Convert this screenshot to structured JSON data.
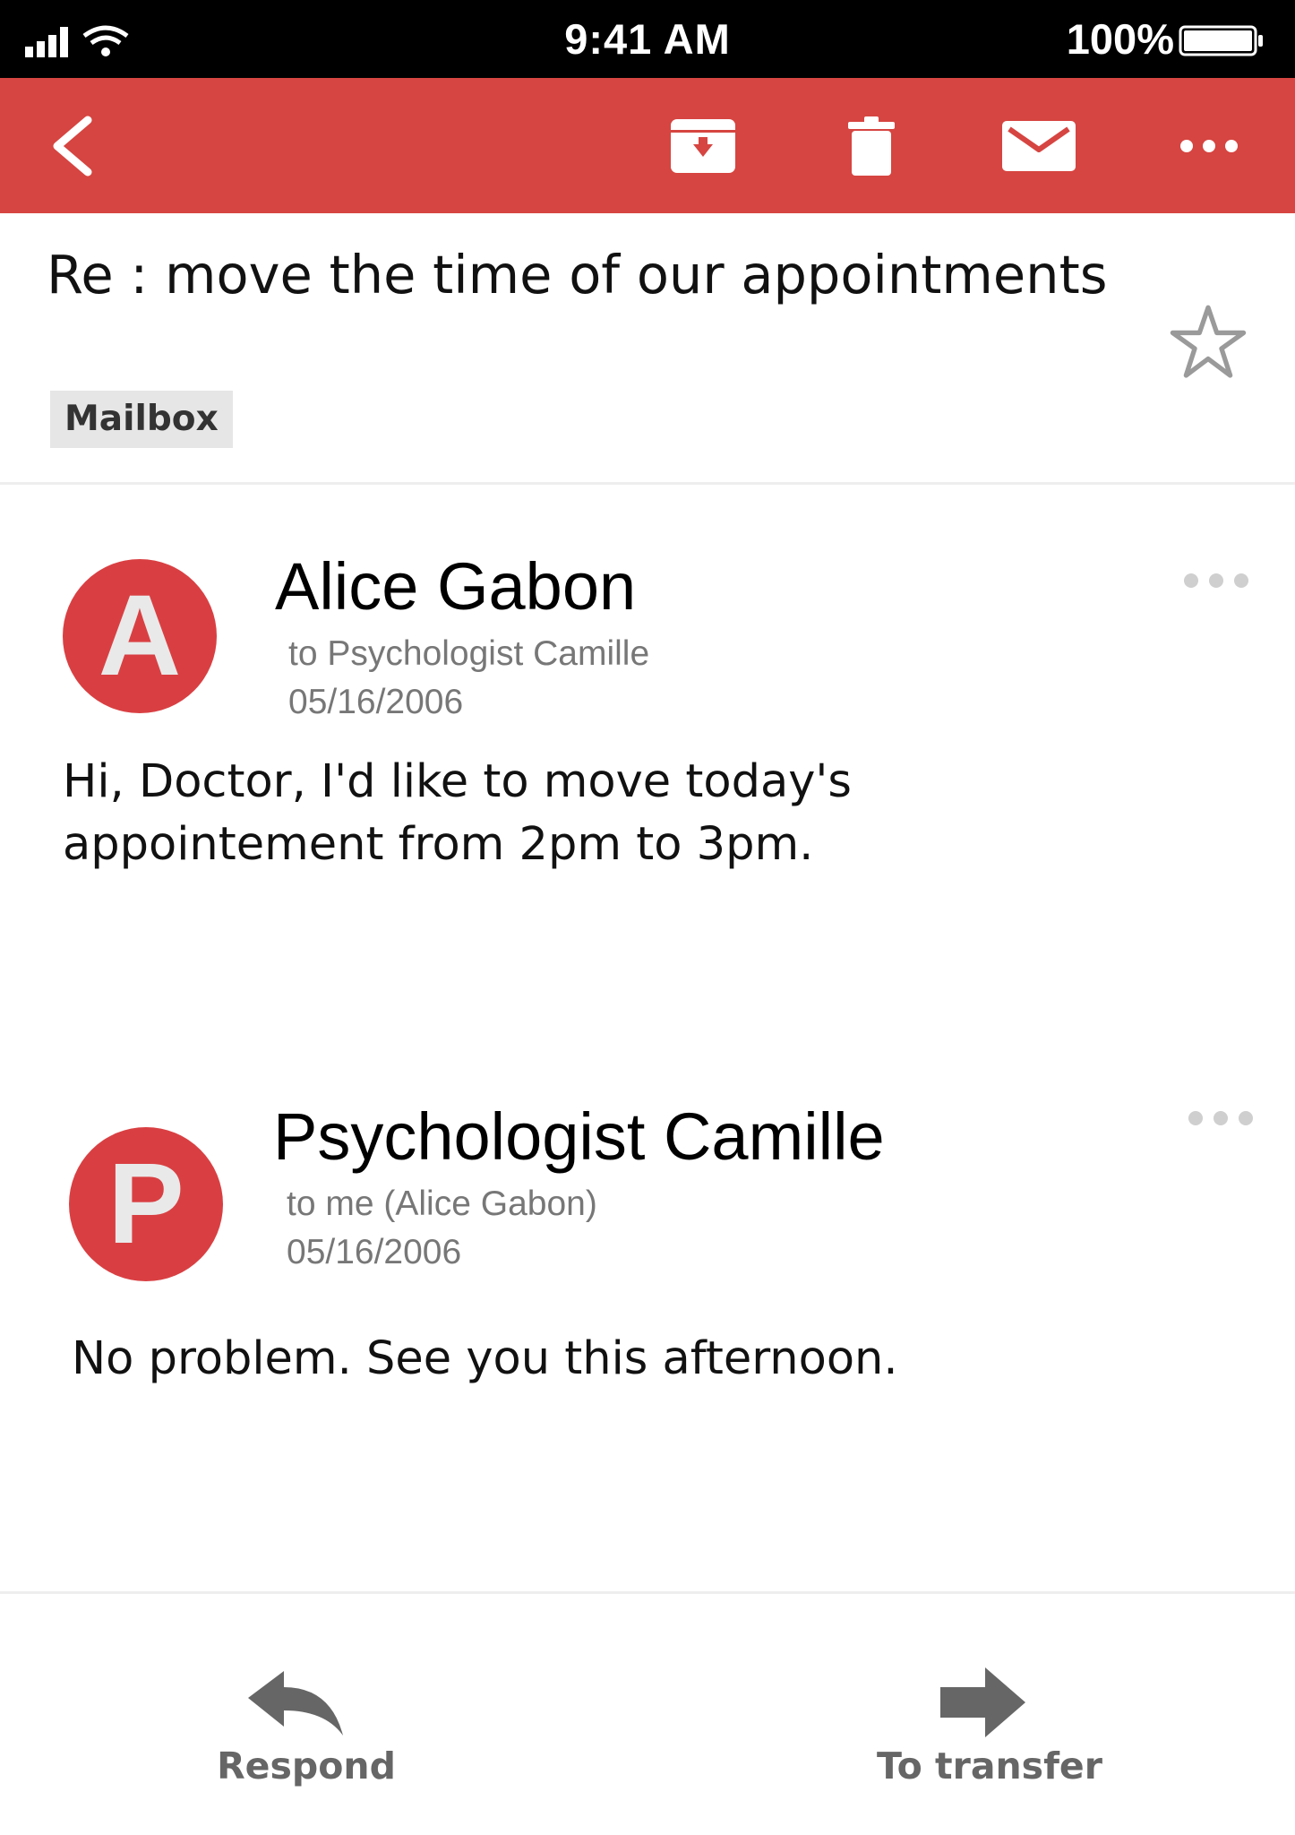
{
  "status_bar": {
    "time": "9:41 AM",
    "battery": "100%"
  },
  "toolbar": {
    "back": "back",
    "archive": "archive",
    "delete": "delete",
    "mark_unread": "mark unread",
    "more": "more"
  },
  "subject": {
    "title": "Re : move the time of our appointments",
    "label": "Mailbox"
  },
  "messages": [
    {
      "avatar_letter": "A",
      "sender": "Alice Gabon",
      "to": "to Psychologist Camille",
      "date": "05/16/2006",
      "body_lines": [
        "Hi, Doctor, I'd like to move today's",
        "appointement from 2pm to 3pm."
      ]
    },
    {
      "avatar_letter": "P",
      "sender": "Psychologist Camille",
      "to": "to me (Alice Gabon)",
      "date": "05/16/2006",
      "body_lines": [
        "No problem. See you this afternoon."
      ]
    }
  ],
  "actions": {
    "respond": "Respond",
    "transfer": "To transfer"
  },
  "colors": {
    "accent": "#d64541",
    "avatar": "#d93f42"
  }
}
